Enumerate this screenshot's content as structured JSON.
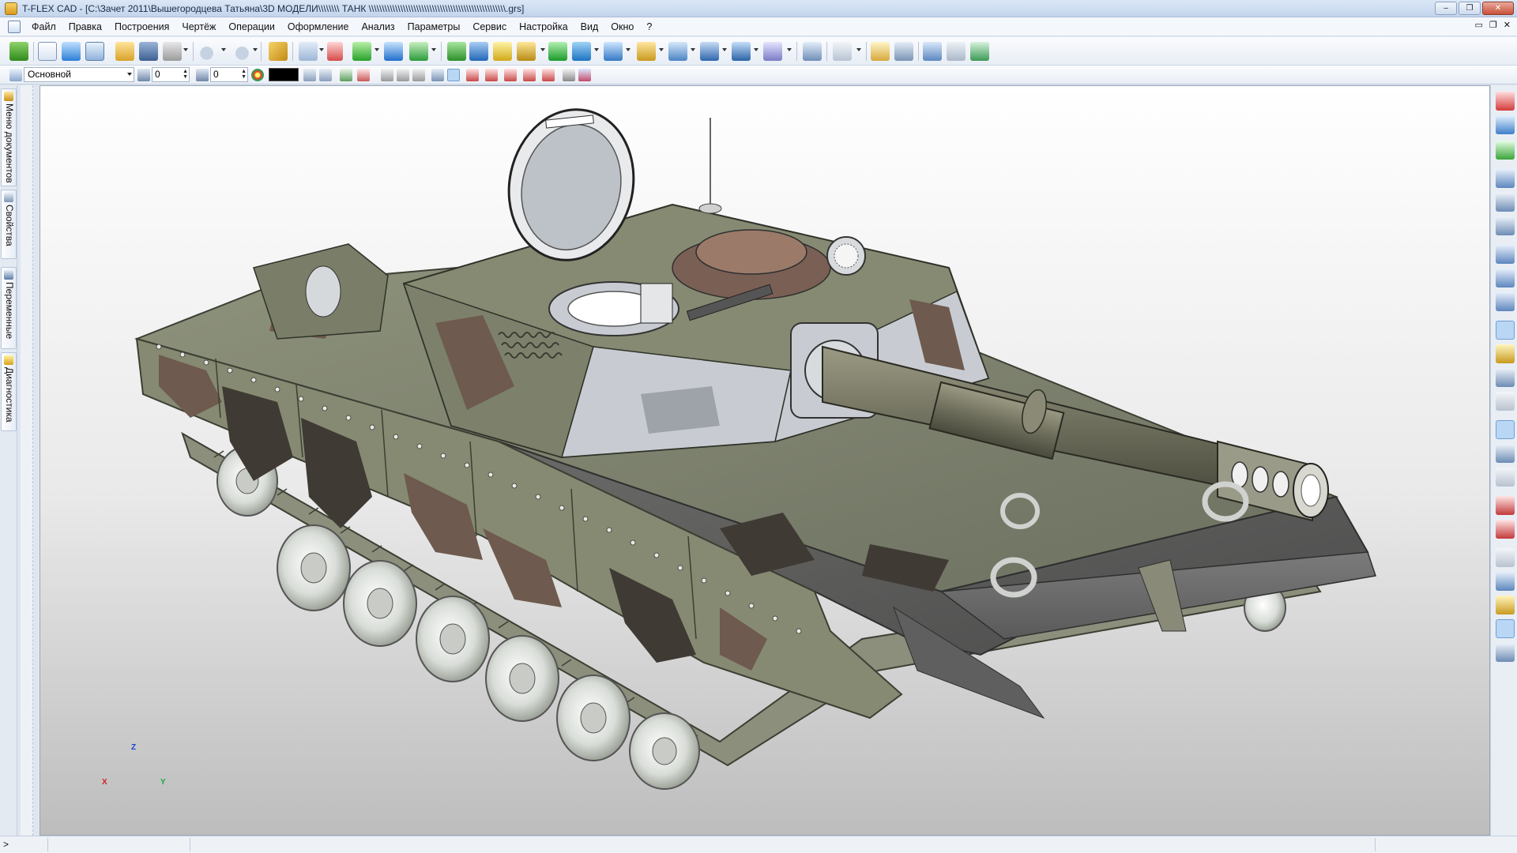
{
  "window": {
    "title": "T-FLEX CAD - [C:\\Зачет 2011\\Вышегородцева Татьяна\\3D МОДЕЛИ\\\\\\\\\\\\\\\\ ТАНК \\\\\\\\\\\\\\\\\\\\\\\\\\\\\\\\\\\\\\\\\\\\\\\\\\\\\\\\\\\\\\\\\\\\\\\\\\\\\\\\\\\\\\\\\\\\\\\\\\\\\\\\.grs]",
    "minimize": "‒",
    "maximize": "❐",
    "close": "✕"
  },
  "menu": [
    "Файл",
    "Правка",
    "Построения",
    "Чертёж",
    "Операции",
    "Оформление",
    "Анализ",
    "Параметры",
    "Сервис",
    "Настройка",
    "Вид",
    "Окно",
    "?"
  ],
  "mdi": {
    "restore": "▭",
    "maximize": "❐",
    "close": "✕"
  },
  "toolbar2": {
    "layer": "Основной",
    "level": "0",
    "priority": "0"
  },
  "left_tabs": [
    "Меню документов",
    "Свойства",
    "Переменные",
    "Диагностика"
  ],
  "axes": {
    "x": "X",
    "y": "Y",
    "z": "Z"
  },
  "status": {
    "prompt": ">"
  },
  "colors": {
    "camo_green": "#8a8f78",
    "camo_brown": "#6e5a4e",
    "camo_dark": "#3f3a34",
    "hull_gray": "#707070",
    "metal": "#c8ccd2"
  }
}
